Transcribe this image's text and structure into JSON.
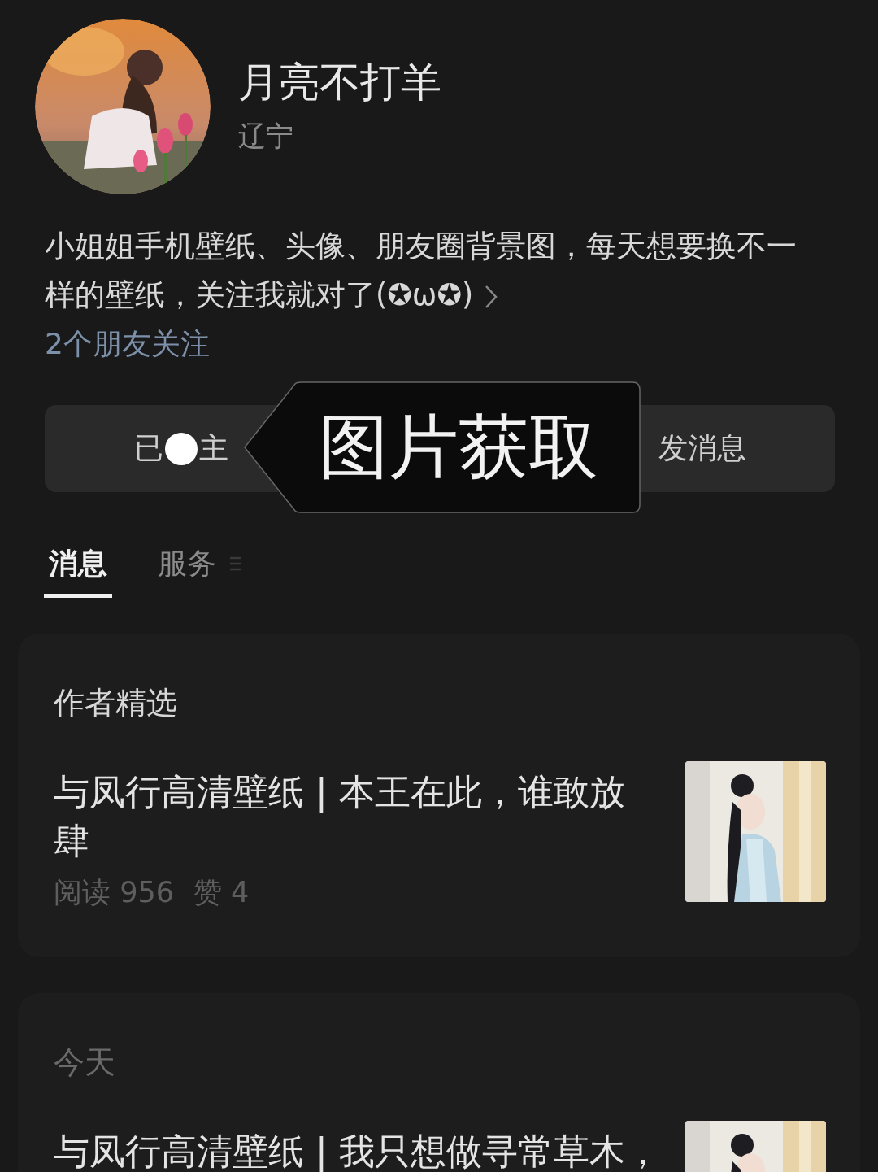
{
  "profile": {
    "name": "月亮不打羊",
    "location": "辽宁",
    "bio": "小姐姐手机壁纸、头像、朋友圈背景图，每天想要换不一样的壁纸，关注我就对了(✪ω✪)",
    "friends": "2个朋友关注"
  },
  "buttons": [
    {
      "kind": "follow",
      "texts": [
        "已",
        "主"
      ]
    },
    {
      "kind": "message",
      "texts": [
        "发消息"
      ]
    }
  ],
  "overlay": {
    "label": "图片获取"
  },
  "tabs": [
    {
      "label": "消息",
      "selected": true
    },
    {
      "label": "服务",
      "selected": false
    }
  ],
  "sections": [
    {
      "heading": "作者精选",
      "articles": [
        {
          "title": "与凤行高清壁纸 | 本王在此，谁敢放肆",
          "stats": [
            "阅读 956",
            "赞 4"
          ]
        }
      ]
    },
    {
      "heading": "今天",
      "articles": [
        {
          "title": "与凤行高清壁纸 | 我只想做寻常草木，"
        }
      ]
    }
  ]
}
